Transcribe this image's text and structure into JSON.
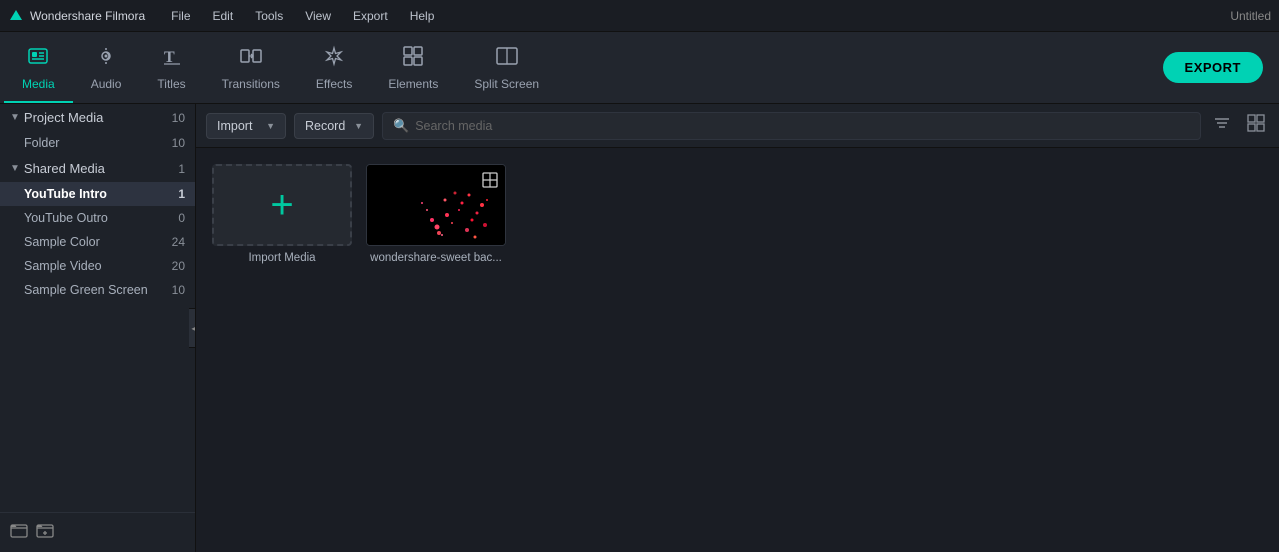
{
  "app": {
    "name": "Wondershare Filmora",
    "title_right": "Untitled"
  },
  "menu": {
    "items": [
      "File",
      "Edit",
      "Tools",
      "View",
      "Export",
      "Help"
    ]
  },
  "toolbar": {
    "items": [
      {
        "id": "media",
        "label": "Media",
        "icon": "🖼",
        "active": true
      },
      {
        "id": "audio",
        "label": "Audio",
        "icon": "♪",
        "active": false
      },
      {
        "id": "titles",
        "label": "Titles",
        "icon": "T",
        "active": false
      },
      {
        "id": "transitions",
        "label": "Transitions",
        "icon": "⇄",
        "active": false
      },
      {
        "id": "effects",
        "label": "Effects",
        "icon": "✦",
        "active": false
      },
      {
        "id": "elements",
        "label": "Elements",
        "icon": "◇",
        "active": false
      },
      {
        "id": "splitscreen",
        "label": "Split Screen",
        "icon": "⊞",
        "active": false
      }
    ],
    "export_label": "EXPORT"
  },
  "sidebar": {
    "sections": [
      {
        "label": "Project Media",
        "count": 10,
        "expanded": true,
        "items": [
          {
            "label": "Folder",
            "count": 10,
            "active": false
          }
        ]
      },
      {
        "label": "Shared Media",
        "count": 1,
        "expanded": true,
        "items": [
          {
            "label": "YouTube Intro",
            "count": 1,
            "active": true
          },
          {
            "label": "YouTube Outro",
            "count": 0,
            "active": false
          },
          {
            "label": "Sample Color",
            "count": 24,
            "active": false
          },
          {
            "label": "Sample Video",
            "count": 20,
            "active": false
          },
          {
            "label": "Sample Green Screen",
            "count": 10,
            "active": false
          }
        ]
      }
    ]
  },
  "content_toolbar": {
    "import_label": "Import",
    "record_label": "Record",
    "search_placeholder": "Search media"
  },
  "media_grid": {
    "items": [
      {
        "id": "import",
        "type": "import",
        "label": "Import Media"
      },
      {
        "id": "video1",
        "type": "video",
        "label": "wondershare-sweet bac..."
      }
    ]
  }
}
